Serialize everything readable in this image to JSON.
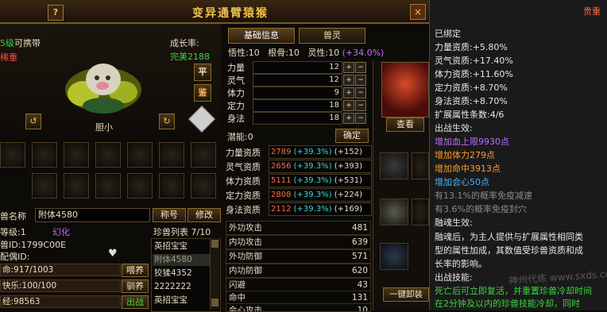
{
  "window": {
    "title": "变异通臂猿猴",
    "help_label": "?",
    "close_label": "×"
  },
  "pet": {
    "carry_level_prefix": "5级",
    "carry_level_suffix": "可携带",
    "rarity": "稀重",
    "growth_label": "成长率:",
    "growth_value": "完美2188",
    "mood": "胆小",
    "ping_label": "平",
    "jian_label": "鉴"
  },
  "tabs": {
    "basic": "基础信息",
    "spirit": "兽灵"
  },
  "attrs_header": {
    "wuxing": "悟性:10",
    "gengu": "根骨:10",
    "lingxing": "灵性:10",
    "lingxing_bonus": "(+34.0%)"
  },
  "attrs": [
    {
      "label": "力量",
      "value": "12"
    },
    {
      "label": "灵气",
      "value": "12"
    },
    {
      "label": "体力",
      "value": "9"
    },
    {
      "label": "定力",
      "value": "18"
    },
    {
      "label": "身法",
      "value": "18"
    }
  ],
  "potential": {
    "label": "潜能:0",
    "confirm": "确定"
  },
  "aptitudes": [
    {
      "label": "力量资质",
      "base": "2789",
      "bonus": "(+39.3%)",
      "extra": "(+152)"
    },
    {
      "label": "灵气资质",
      "base": "2656",
      "bonus": "(+39.3%)",
      "extra": "(+393)"
    },
    {
      "label": "体力资质",
      "base": "5111",
      "bonus": "(+39.3%)",
      "extra": "(+531)"
    },
    {
      "label": "定力资质",
      "base": "2808",
      "bonus": "(+39.3%)",
      "extra": "(+224)"
    },
    {
      "label": "身法资质",
      "base": "2112",
      "bonus": "(+39.3%)",
      "extra": "(+169)"
    }
  ],
  "name_row": {
    "label": "兽名称",
    "value": "附体4580",
    "title_btn": "称号",
    "rename_btn": "修改"
  },
  "info": {
    "level_label": "等级:1",
    "huanhua": "幻化",
    "id_line": "兽ID:1799C00E",
    "partner_line": "配偶ID:",
    "hp_line": "命:917/1003",
    "happy_line": "快乐:100/100",
    "exp_line": "经:98563",
    "feed_btn": "喂养",
    "tame_btn": "驯养",
    "battle_btn": "出战"
  },
  "pet_list": {
    "title": "珍兽列表 7/10",
    "items": [
      "英招宝宝",
      "附体4580",
      "狡猱4352",
      "2222222",
      "英招宝宝"
    ]
  },
  "combat_stats": [
    {
      "label": "外功攻击",
      "value": "481"
    },
    {
      "label": "内功攻击",
      "value": "639"
    },
    {
      "label": "外功防御",
      "value": "571"
    },
    {
      "label": "内功防御",
      "value": "620"
    },
    {
      "label": "闪避",
      "value": "43"
    },
    {
      "label": "命中",
      "value": "131"
    },
    {
      "label": "会心攻击",
      "value": "10"
    }
  ],
  "equip": {
    "view_btn": "查看",
    "one_key_btn": "一键卸装"
  },
  "tooltip": {
    "rarity": "贵重",
    "bound": "已绑定",
    "lines": [
      "力量资质:+5.80%",
      "灵气资质:+17.40%",
      "体力资质:+11.60%",
      "定力资质:+8.70%",
      "身法资质:+8.70%",
      "扩展属性条数:4/6",
      "出战生效:"
    ],
    "effects": [
      "增加血上限9930点",
      "增加体力279点",
      "增加命中3913点",
      "增加会心50点"
    ],
    "gray_lines": [
      "有13.1%的概率免疫减速",
      "有3.6%的概率免疫封穴"
    ],
    "fusion_header": "融魂生效:",
    "fusion_text": [
      "融魂后，为主人提供与扩展属性相同类",
      "型的属性加成，其数值受珍兽资质和成",
      "长率的影响。"
    ],
    "skill_header": "出战技能:",
    "skill_text": [
      "死亡后可立即复活，并重置珍兽冷却时间",
      "在2分钟及以内的珍兽技能冷却，同时"
    ],
    "watermark": "神州代练  www.sxds.com"
  },
  "colors": {
    "gold": "#f0c24a",
    "green": "#3fd43f",
    "purple": "#c36bff",
    "orange": "#ff9a2a",
    "blue": "#4ab0ff"
  }
}
